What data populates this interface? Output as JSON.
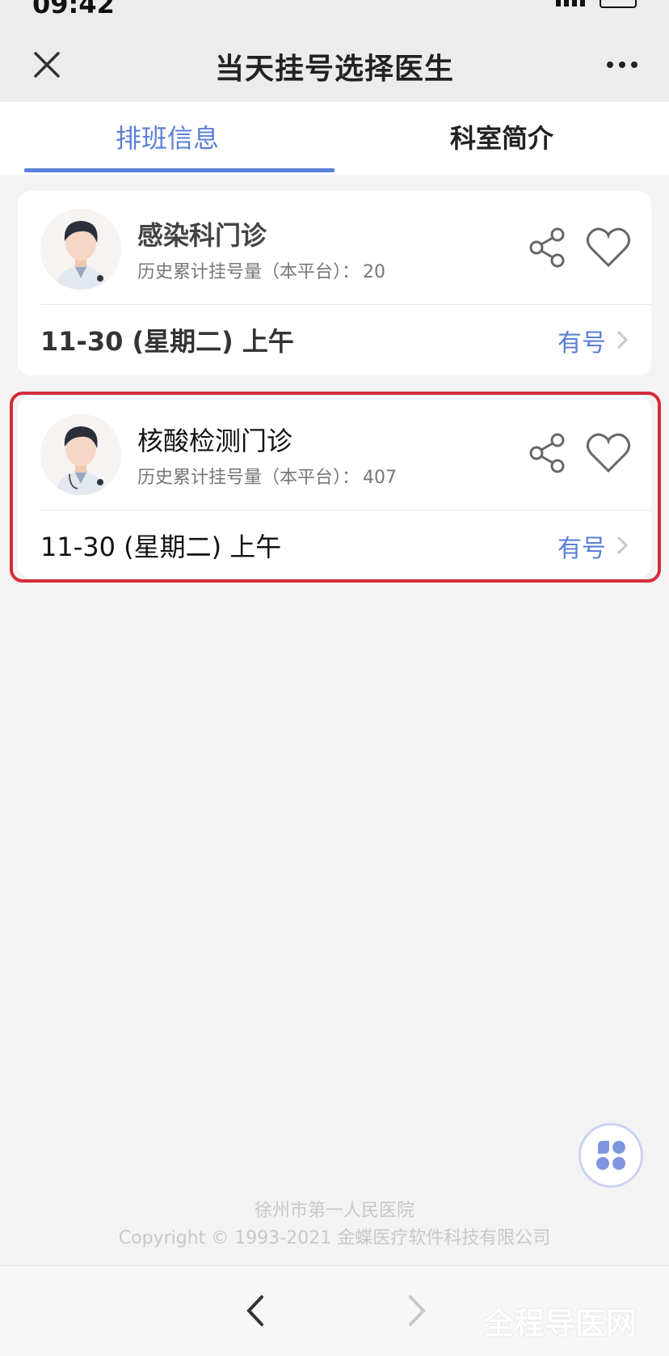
{
  "status_bar": {
    "time": "09:42"
  },
  "nav": {
    "title": "当天挂号选择医生"
  },
  "tabs": [
    {
      "label": "排班信息",
      "active": true
    },
    {
      "label": "科室简介",
      "active": false
    }
  ],
  "cards": [
    {
      "dept": "感染科门诊",
      "history_label": "历史累计挂号量（本平台）：",
      "history_count": "20",
      "slot_date": "11-30 (星期二)  上午",
      "slot_status": "有号",
      "highlighted": false
    },
    {
      "dept": "核酸检测门诊",
      "history_label": "历史累计挂号量（本平台）：",
      "history_count": "407",
      "slot_date": "11-30 (星期二)  上午",
      "slot_status": "有号",
      "highlighted": true
    }
  ],
  "footer": {
    "hospital": "徐州市第一人民医院",
    "copyright": "Copyright © 1993-2021 金蝶医疗软件科技有限公司"
  },
  "watermark": "全程导医网",
  "colors": {
    "accent": "#5b7fd6",
    "highlight_border": "#d62b3a",
    "background": "#f3f3f3"
  }
}
